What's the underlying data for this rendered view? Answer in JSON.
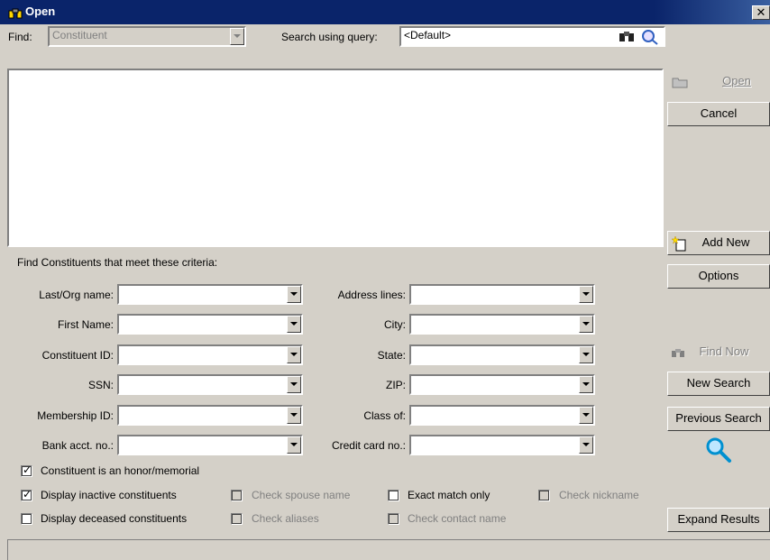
{
  "window": {
    "title": "Open",
    "close_glyph": "✕"
  },
  "find": {
    "label": "Find:",
    "value": "Constituent"
  },
  "query": {
    "label": "Search using query:",
    "value": "<Default>"
  },
  "buttons": {
    "open": "Open",
    "cancel": "Cancel",
    "add_new": "Add New",
    "options": "Options",
    "find_now": "Find Now",
    "new_search": "New Search",
    "previous_search": "Previous Search",
    "expand_results": "Expand Results"
  },
  "criteria_heading": "Find Constituents that meet these criteria:",
  "fields_left": [
    {
      "label": "Last/Org name:",
      "value": ""
    },
    {
      "label": "First Name:",
      "value": ""
    },
    {
      "label": "Constituent ID:",
      "value": ""
    },
    {
      "label": "SSN:",
      "value": ""
    },
    {
      "label": "Membership ID:",
      "value": ""
    },
    {
      "label": "Bank acct. no.:",
      "value": ""
    }
  ],
  "fields_right": [
    {
      "label": "Address lines:",
      "value": ""
    },
    {
      "label": "City:",
      "value": ""
    },
    {
      "label": "State:",
      "value": ""
    },
    {
      "label": "ZIP:",
      "value": ""
    },
    {
      "label": "Class of:",
      "value": ""
    },
    {
      "label": "Credit card no.:",
      "value": ""
    }
  ],
  "checkboxes": {
    "honor_memorial": {
      "label": "Constituent is an honor/memorial",
      "checked": true
    },
    "inactive": {
      "label": "Display inactive constituents",
      "checked": true
    },
    "deceased": {
      "label": "Display deceased constituents",
      "checked": false
    },
    "spouse_name": {
      "label": "Check spouse name",
      "checked": false
    },
    "aliases": {
      "label": "Check aliases",
      "checked": false
    },
    "exact_match": {
      "label": "Exact match only",
      "checked": false
    },
    "contact_name": {
      "label": "Check contact name",
      "checked": false
    },
    "nickname": {
      "label": "Check nickname",
      "checked": false
    }
  },
  "colors": {
    "titlebar": "#0a246a",
    "face": "#d4d0c8",
    "disabled_text": "#808080"
  },
  "icons": [
    "binoculars-icon",
    "close-icon",
    "folder-icon",
    "new-item-icon",
    "magnifier-icon",
    "dropdown-arrow-icon"
  ]
}
